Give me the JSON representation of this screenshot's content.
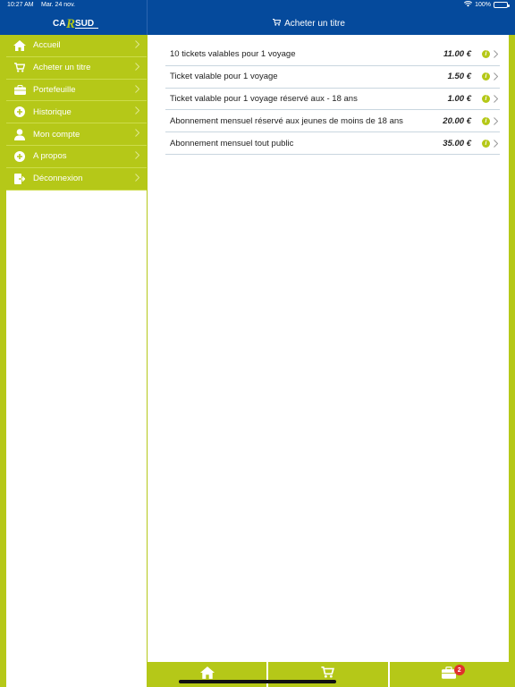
{
  "status": {
    "time": "10:27 AM",
    "date": "Mar. 24 nov.",
    "battery": "100%",
    "battery_level": 1.0
  },
  "brand": {
    "logo_text": "CARSUD",
    "primary_color": "#054a9c",
    "accent_color": "#b5c818",
    "badge_color": "#e0312b"
  },
  "header": {
    "title": "Acheter un titre",
    "title_icon": "cart-icon"
  },
  "sidebar": {
    "items": [
      {
        "label": "Accueil",
        "icon": "home-icon"
      },
      {
        "label": "Acheter un titre",
        "icon": "cart-icon"
      },
      {
        "label": "Portefeuille",
        "icon": "wallet-icon"
      },
      {
        "label": "Historique",
        "icon": "plus-circle-icon"
      },
      {
        "label": "Mon compte",
        "icon": "user-icon"
      },
      {
        "label": "A propos",
        "icon": "plus-circle-icon"
      },
      {
        "label": "Déconnexion",
        "icon": "logout-icon"
      }
    ]
  },
  "tickets": [
    {
      "label": "10 tickets valables pour 1 voyage",
      "price": "11.00 €"
    },
    {
      "label": "Ticket valable pour 1 voyage",
      "price": "1.50 €"
    },
    {
      "label": "Ticket valable pour 1 voyage réservé aux - 18 ans",
      "price": "1.00 €"
    },
    {
      "label": "Abonnement mensuel réservé aux jeunes de moins de 18 ans",
      "price": "20.00 €"
    },
    {
      "label": "Abonnement mensuel tout public",
      "price": "35.00 €"
    }
  ],
  "tabbar": {
    "tabs": [
      {
        "icon": "home-icon"
      },
      {
        "icon": "cart-icon"
      },
      {
        "icon": "wallet-icon",
        "badge": "2"
      }
    ]
  }
}
